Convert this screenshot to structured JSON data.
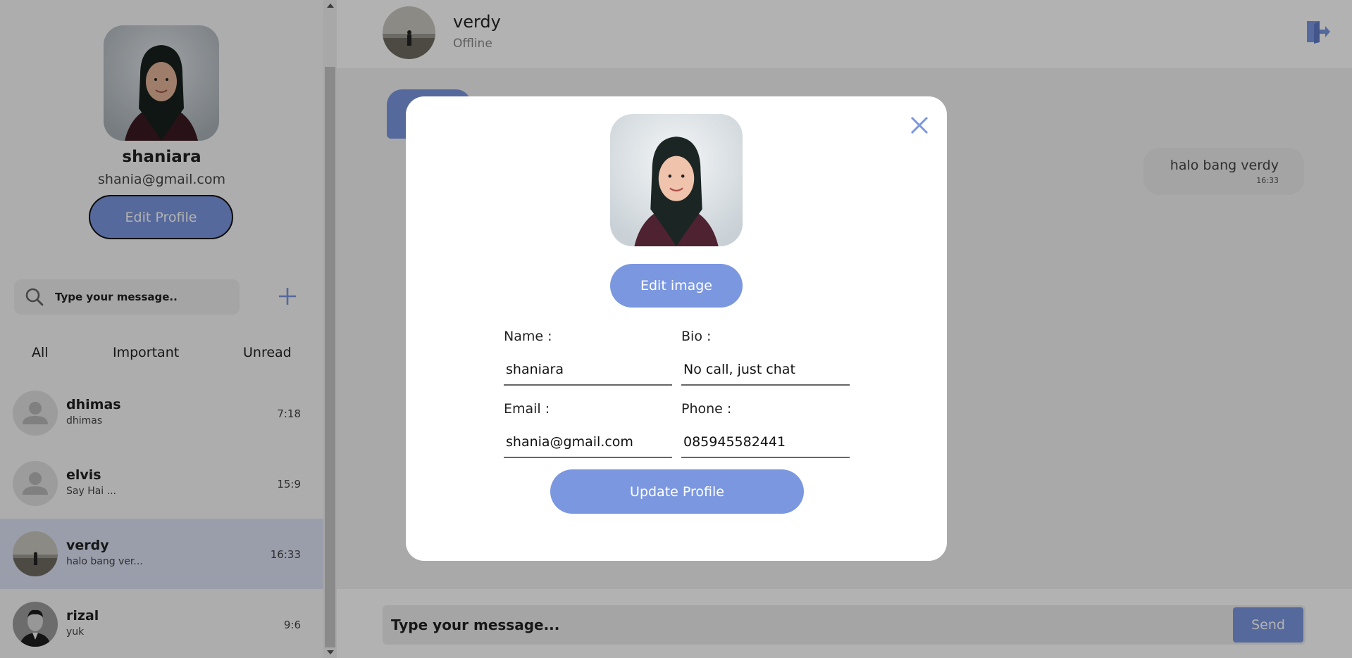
{
  "sidebar": {
    "profile": {
      "name": "shaniara",
      "email": "shania@gmail.com",
      "edit_label": "Edit Profile"
    },
    "search": {
      "placeholder": "Type your message.."
    },
    "filters": [
      "All",
      "Important",
      "Unread"
    ],
    "chats": [
      {
        "name": "dhimas",
        "preview": "dhimas",
        "time": "7:18"
      },
      {
        "name": "elvis",
        "preview": "Say Hai ...",
        "time": "15:9"
      },
      {
        "name": "verdy",
        "preview": "halo bang ver...",
        "time": "16:33"
      },
      {
        "name": "rizal",
        "preview": "yuk",
        "time": "9:6"
      }
    ]
  },
  "chat": {
    "contact": {
      "name": "verdy",
      "status": "Offline"
    },
    "messages": [
      {
        "text": "halo bang verdy",
        "time": "16:33"
      }
    ],
    "composer": {
      "placeholder": "Type your message...",
      "send_label": "Send"
    }
  },
  "modal": {
    "edit_image_label": "Edit image",
    "fields": {
      "name": {
        "label": "Name :",
        "value": "shaniara"
      },
      "bio": {
        "label": "Bio :",
        "value": "No call, just chat"
      },
      "email": {
        "label": "Email :",
        "value": "shania@gmail.com"
      },
      "phone": {
        "label": "Phone :",
        "value": "085945582441"
      }
    },
    "update_label": "Update Profile"
  },
  "colors": {
    "accent": "#7b97e0",
    "active_chat": "#dde3f5",
    "overlay": "rgba(0,0,0,0.30)"
  }
}
